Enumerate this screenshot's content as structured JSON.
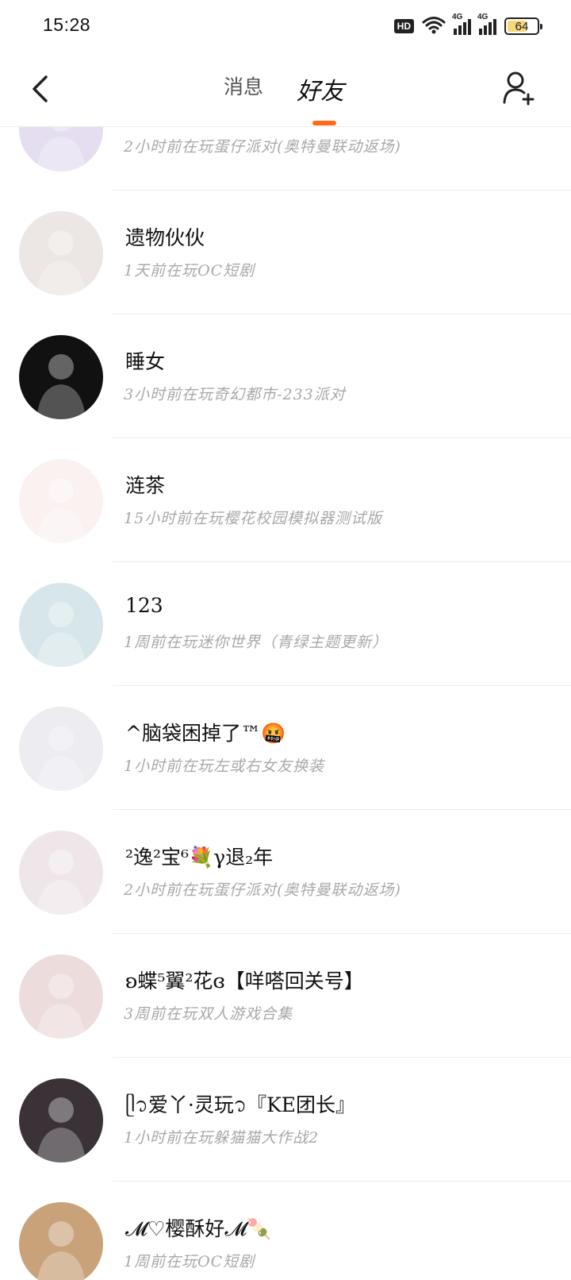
{
  "status_bar": {
    "time": "15:28",
    "hd_label": "HD",
    "signal1_label": "4G",
    "signal2_label": "4G",
    "battery_level": "64",
    "battery_fill_fraction": 0.64,
    "battery_color": "#f3d77a"
  },
  "nav": {
    "back_icon": "chevron-left-icon",
    "tab_messages": "消息",
    "tab_friends": "好友",
    "active_tab": "friends",
    "accent_color": "#ff6a1a",
    "add_friend_icon": "add-user-icon"
  },
  "friends": [
    {
      "name": "",
      "activity": "2小时前在玩蛋仔派对(奥特曼联动返场)",
      "avatar_color": "#e4def0"
    },
    {
      "name": "遗物伙伙",
      "activity": "1天前在玩OC短剧",
      "avatar_color": "#ece6e4"
    },
    {
      "name": "睡女",
      "activity": "3小时前在玩奇幻都市-233派对",
      "avatar_color": "#111111"
    },
    {
      "name": "涟茶",
      "activity": "15小时前在玩樱花校园模拟器测试版",
      "avatar_color": "#fbf1f1"
    },
    {
      "name": "123",
      "activity": "1周前在玩迷你世界（青绿主题更新）",
      "avatar_color": "#d7e6ea"
    },
    {
      "name": "^脑袋困掉了™🤬",
      "activity": "1小时前在玩左或右女友换装",
      "avatar_color": "#ececf1"
    },
    {
      "name": "²逸²宝⁶💐γ退₂年",
      "activity": "2小时前在玩蛋仔派对(奥特曼联动返场)",
      "avatar_color": "#efe6ea"
    },
    {
      "name": "ʚ蝶⁵翼²花ɞ【咩嗒回关号】",
      "activity": "3周前在玩双人游戏合集",
      "avatar_color": "#ecdcdc"
    },
    {
      "name": "ᥫ᭡爱丫·灵玩᭡『KE团长』",
      "activity": "1小时前在玩躲猫猫大作战2",
      "avatar_color": "#3a3236"
    },
    {
      "name": "𝓜♡樱酥好𝓜🍡",
      "activity": "1周前在玩OC短剧",
      "avatar_color": "#c9a27a"
    }
  ]
}
